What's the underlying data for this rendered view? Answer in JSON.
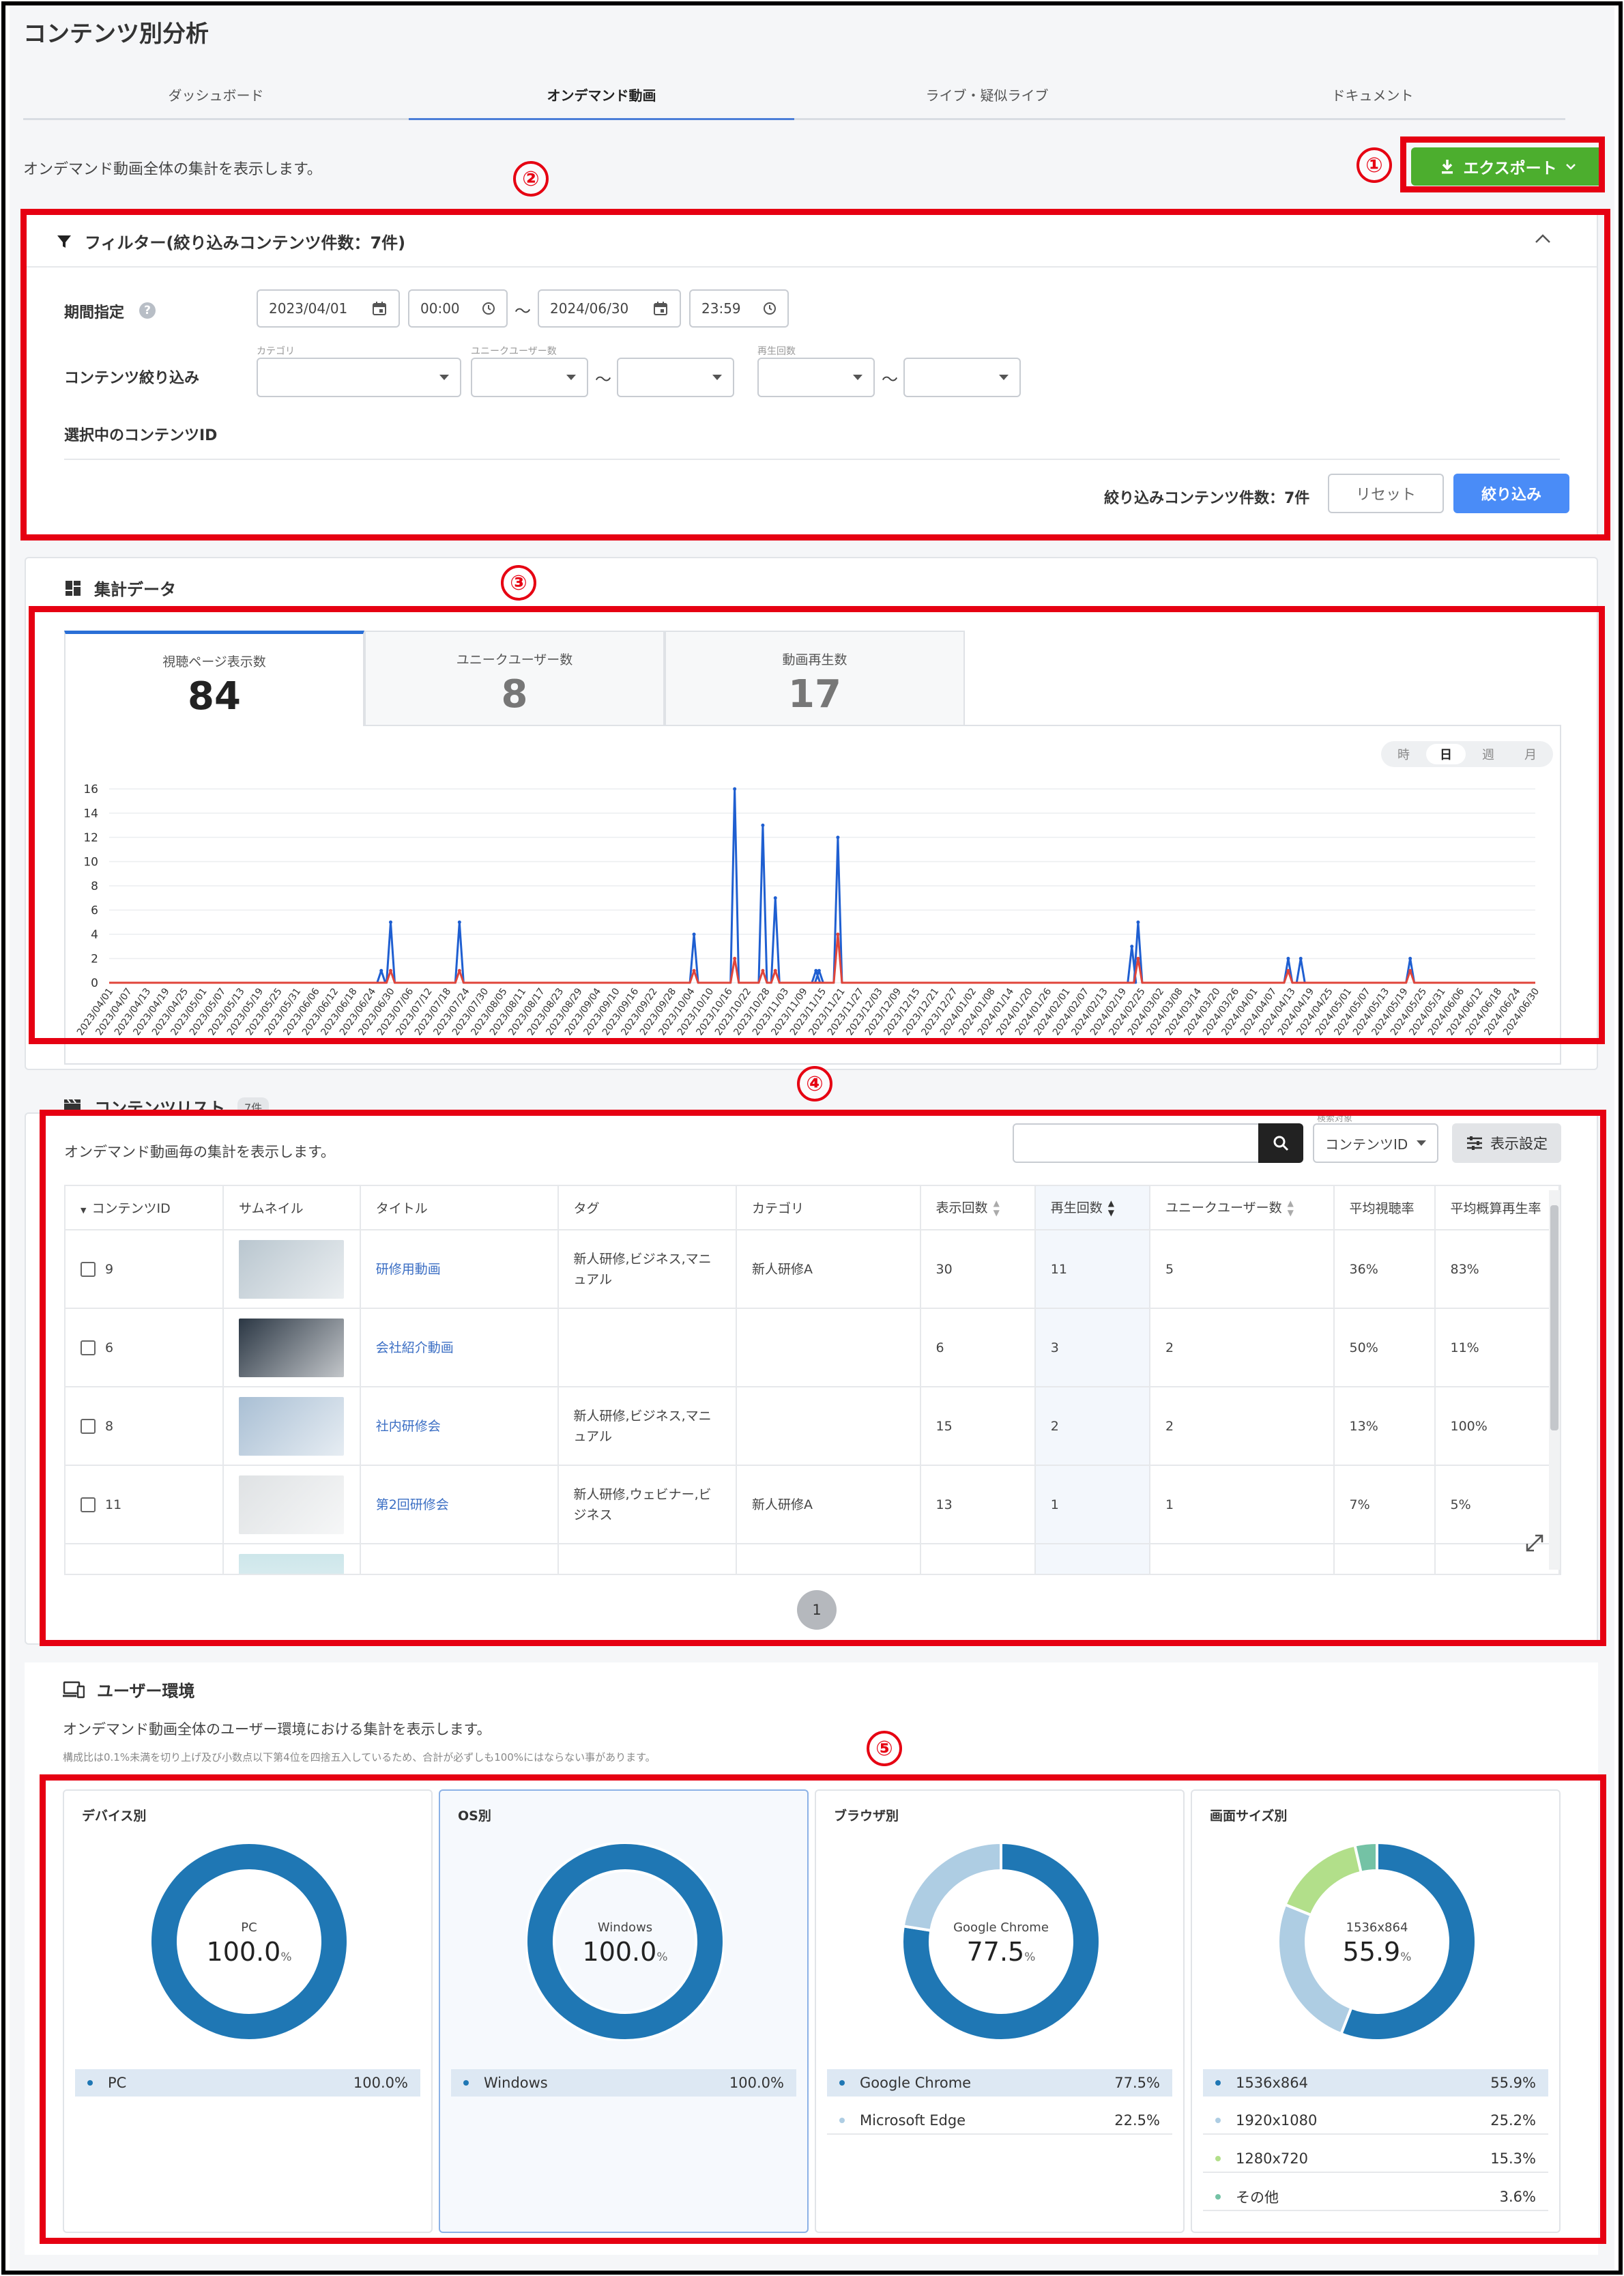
{
  "page_title": "コンテンツ別分析",
  "tabs": [
    "ダッシュボード",
    "オンデマンド動画",
    "ライブ・疑似ライブ",
    "ドキュメント"
  ],
  "description": "オンデマンド動画全体の集計を表示します。",
  "export_label": "エクスポート",
  "markers": [
    "①",
    "②",
    "③",
    "④",
    "⑤"
  ],
  "filter": {
    "title": "フィルター(絞り込みコンテンツ件数：7件)",
    "period_label": "期間指定",
    "start_date": "2023/04/01",
    "start_time": "00:00",
    "range_sep": "～",
    "end_date": "2024/06/30",
    "end_time": "23:59",
    "narrow_label": "コンテンツ絞り込み",
    "category_label": "カテゴリ",
    "unique_users_label": "ユニークユーザー数",
    "plays_label": "再生回数",
    "selected_ids_label": "選択中のコンテンツID",
    "count_text": "絞り込みコンテンツ件数：7件",
    "reset_label": "リセット",
    "apply_label": "絞り込み"
  },
  "aggregate": {
    "title": "集計データ",
    "tabs": [
      {
        "label": "視聴ページ表示数",
        "value": "84"
      },
      {
        "label": "ユニークユーザー数",
        "value": "8"
      },
      {
        "label": "動画再生数",
        "value": "17"
      }
    ],
    "granularity": [
      "時",
      "日",
      "週",
      "月"
    ],
    "granularity_selected": "日"
  },
  "chart_data": {
    "type": "line",
    "y_ticks": [
      "0",
      "2",
      "4",
      "6",
      "8",
      "10",
      "12",
      "14",
      "16"
    ],
    "ylim": [
      0,
      16
    ],
    "grid": true,
    "x_start": "2023/04/01",
    "x_end": "2024/06/30",
    "x_tick_interval_days": 6,
    "series": [
      {
        "color": "#1f5fd1",
        "points": [
          [
            "2023/06/27",
            1
          ],
          [
            "2023/06/30",
            5
          ],
          [
            "2023/07/22",
            5
          ],
          [
            "2023/10/05",
            4
          ],
          [
            "2023/10/18",
            16
          ],
          [
            "2023/10/27",
            13
          ],
          [
            "2023/10/31",
            7
          ],
          [
            "2023/11/13",
            1
          ],
          [
            "2023/11/14",
            1
          ],
          [
            "2023/11/20",
            12
          ],
          [
            "2024/02/22",
            3
          ],
          [
            "2024/02/24",
            5
          ],
          [
            "2024/04/12",
            2
          ],
          [
            "2024/04/16",
            2
          ],
          [
            "2024/05/21",
            2
          ]
        ]
      },
      {
        "color": "#e0453a",
        "points": [
          [
            "2023/06/30",
            1
          ],
          [
            "2023/07/22",
            1
          ],
          [
            "2023/10/05",
            1
          ],
          [
            "2023/10/18",
            2
          ],
          [
            "2023/10/27",
            1
          ],
          [
            "2023/10/31",
            1
          ],
          [
            "2023/11/20",
            4
          ],
          [
            "2024/02/24",
            2
          ],
          [
            "2024/04/12",
            1
          ],
          [
            "2024/05/21",
            1
          ]
        ]
      }
    ]
  },
  "content_list": {
    "title": "コンテンツリスト",
    "count_badge": "7件",
    "description": "オンデマンド動画毎の集計を表示します。",
    "search_target_label": "検索対象",
    "search_select": "コンテンツID",
    "settings_label": "表示設定",
    "columns": [
      "コンテンツID",
      "サムネイル",
      "タイトル",
      "タグ",
      "カテゴリ",
      "表示回数",
      "再生回数",
      "ユニークユーザー数",
      "平均視聴率",
      "平均概算再生率"
    ],
    "rows": [
      {
        "id": "9",
        "title": "研修用動画",
        "tags": "新人研修,ビジネス,マニュアル",
        "category": "新人研修A",
        "views": "30",
        "plays": "11",
        "users": "5",
        "avg_watch": "36%",
        "avg_play": "83%",
        "thumb": "#b9c6cf"
      },
      {
        "id": "6",
        "title": "会社紹介動画",
        "tags": "",
        "category": "",
        "views": "6",
        "plays": "3",
        "users": "2",
        "avg_watch": "50%",
        "avg_play": "11%",
        "thumb": "#2b3744"
      },
      {
        "id": "8",
        "title": "社内研修会",
        "tags": "新人研修,ビジネス,マニュアル",
        "category": "",
        "views": "15",
        "plays": "2",
        "users": "2",
        "avg_watch": "13%",
        "avg_play": "100%",
        "thumb": "#a9bfd4"
      },
      {
        "id": "11",
        "title": "第2回研修会",
        "tags": "新人研修,ウェビナー,ビジネス",
        "category": "新人研修A",
        "views": "13",
        "plays": "1",
        "users": "1",
        "avg_watch": "7%",
        "avg_play": "5%",
        "thumb": "#dfe2e4"
      }
    ],
    "page": "1"
  },
  "user_env": {
    "title": "ユーザー環境",
    "description": "オンデマンド動画全体のユーザー環境における集計を表示します。",
    "note": "構成比は0.1%未満を切り上げ及び小数点以下第4位を四捨五入しているため、合計が必ずしも100%にはならない事があります。",
    "cards": [
      {
        "title": "デバイス別",
        "center_label": "PC",
        "center_value": "100.0",
        "center_unit": "%",
        "items": [
          {
            "name": "PC",
            "value": "100.0%",
            "pct": 100.0,
            "color": "#1f77b4"
          }
        ]
      },
      {
        "title": "OS別",
        "center_label": "Windows",
        "center_value": "100.0",
        "center_unit": "%",
        "items": [
          {
            "name": "Windows",
            "value": "100.0%",
            "pct": 100.0,
            "color": "#1f77b4"
          }
        ]
      },
      {
        "title": "ブラウザ別",
        "center_label": "Google Chrome",
        "center_value": "77.5",
        "center_unit": "%",
        "items": [
          {
            "name": "Google Chrome",
            "value": "77.5%",
            "pct": 77.5,
            "color": "#1f77b4"
          },
          {
            "name": "Microsoft Edge",
            "value": "22.5%",
            "pct": 22.5,
            "color": "#aecde3"
          }
        ]
      },
      {
        "title": "画面サイズ別",
        "center_label": "1536x864",
        "center_value": "55.9",
        "center_unit": "%",
        "items": [
          {
            "name": "1536x864",
            "value": "55.9%",
            "pct": 55.9,
            "color": "#1f77b4"
          },
          {
            "name": "1920x1080",
            "value": "25.2%",
            "pct": 25.2,
            "color": "#aecde3"
          },
          {
            "name": "1280x720",
            "value": "15.3%",
            "pct": 15.3,
            "color": "#b2df8a"
          },
          {
            "name": "その他",
            "value": "3.6%",
            "pct": 3.6,
            "color": "#74c2a5"
          }
        ]
      }
    ]
  }
}
